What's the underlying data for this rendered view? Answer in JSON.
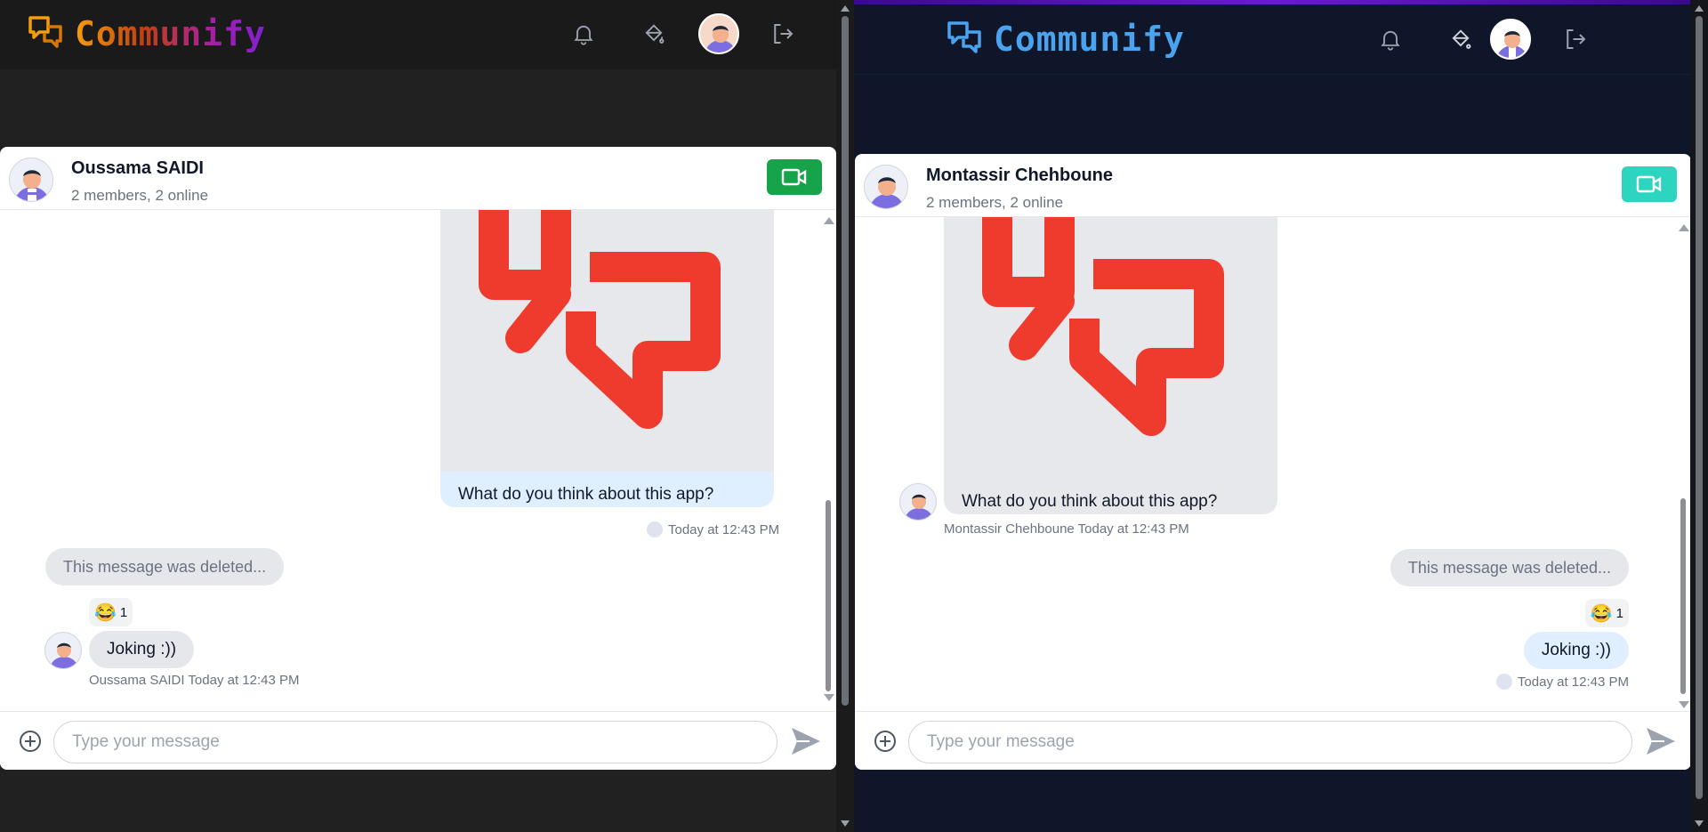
{
  "brand": {
    "name": "Communify"
  },
  "left": {
    "chat": {
      "name": "Oussama SAIDI",
      "members": "2 members, 2 online",
      "image_caption": "What do you think about this app?",
      "image_meta": "Today at 12:43 PM",
      "deleted_text": "This message was deleted...",
      "reaction": {
        "emoji": "😂",
        "count": "1"
      },
      "reply_text": "Joking :))",
      "reply_meta": "Oussama SAIDI Today at 12:43 PM"
    },
    "composer": {
      "placeholder": "Type your message"
    }
  },
  "right": {
    "chat": {
      "name": "Montassir Chehboune",
      "members": "2 members, 2 online",
      "image_caption": "What do you think about this app?",
      "image_meta": "Montassir Chehboune Today at 12:43 PM",
      "deleted_text": "This message was deleted...",
      "reaction": {
        "emoji": "😂",
        "count": "1"
      },
      "reply_text": "Joking :))",
      "reply_meta": "Today at 12:43 PM"
    },
    "composer": {
      "placeholder": "Type your message"
    }
  },
  "colors": {
    "left_video_button": "#16a34a",
    "right_video_button": "#2dd4bf",
    "logo_red": "#ef3b2d",
    "left_brand_gradient": [
      "#f59e0b",
      "#a21caf"
    ],
    "right_brand": "#4aa3ef"
  },
  "icons": [
    "chat-bubbles-icon",
    "bell-icon",
    "paint-bucket-icon",
    "logout-icon",
    "video-camera-icon",
    "plus-circle-icon",
    "send-icon"
  ]
}
